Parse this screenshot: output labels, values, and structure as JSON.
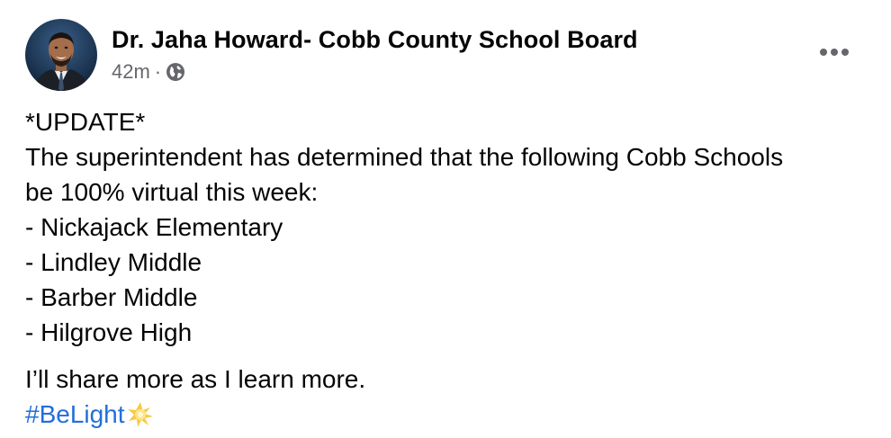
{
  "post": {
    "author": "Dr. Jaha Howard- Cobb County School Board",
    "time": "42m",
    "separator": "·",
    "visibility_icon": "globe-icon",
    "more_icon": "more-options-icon",
    "body_lines": [
      "*UPDATE*",
      "The superintendent has determined that the following Cobb Schools",
      "be 100% virtual this week:",
      "- Nickajack Elementary",
      "- Lindley Middle",
      "- Barber Middle",
      "- Hilgrove High"
    ],
    "closing": "I’ll share more as I learn more.",
    "hashtag": "#BeLight",
    "hashtag_emoji": "sparkle-star-emoji"
  },
  "colors": {
    "text": "#050505",
    "secondary": "#65676b",
    "link": "#216fdb"
  }
}
